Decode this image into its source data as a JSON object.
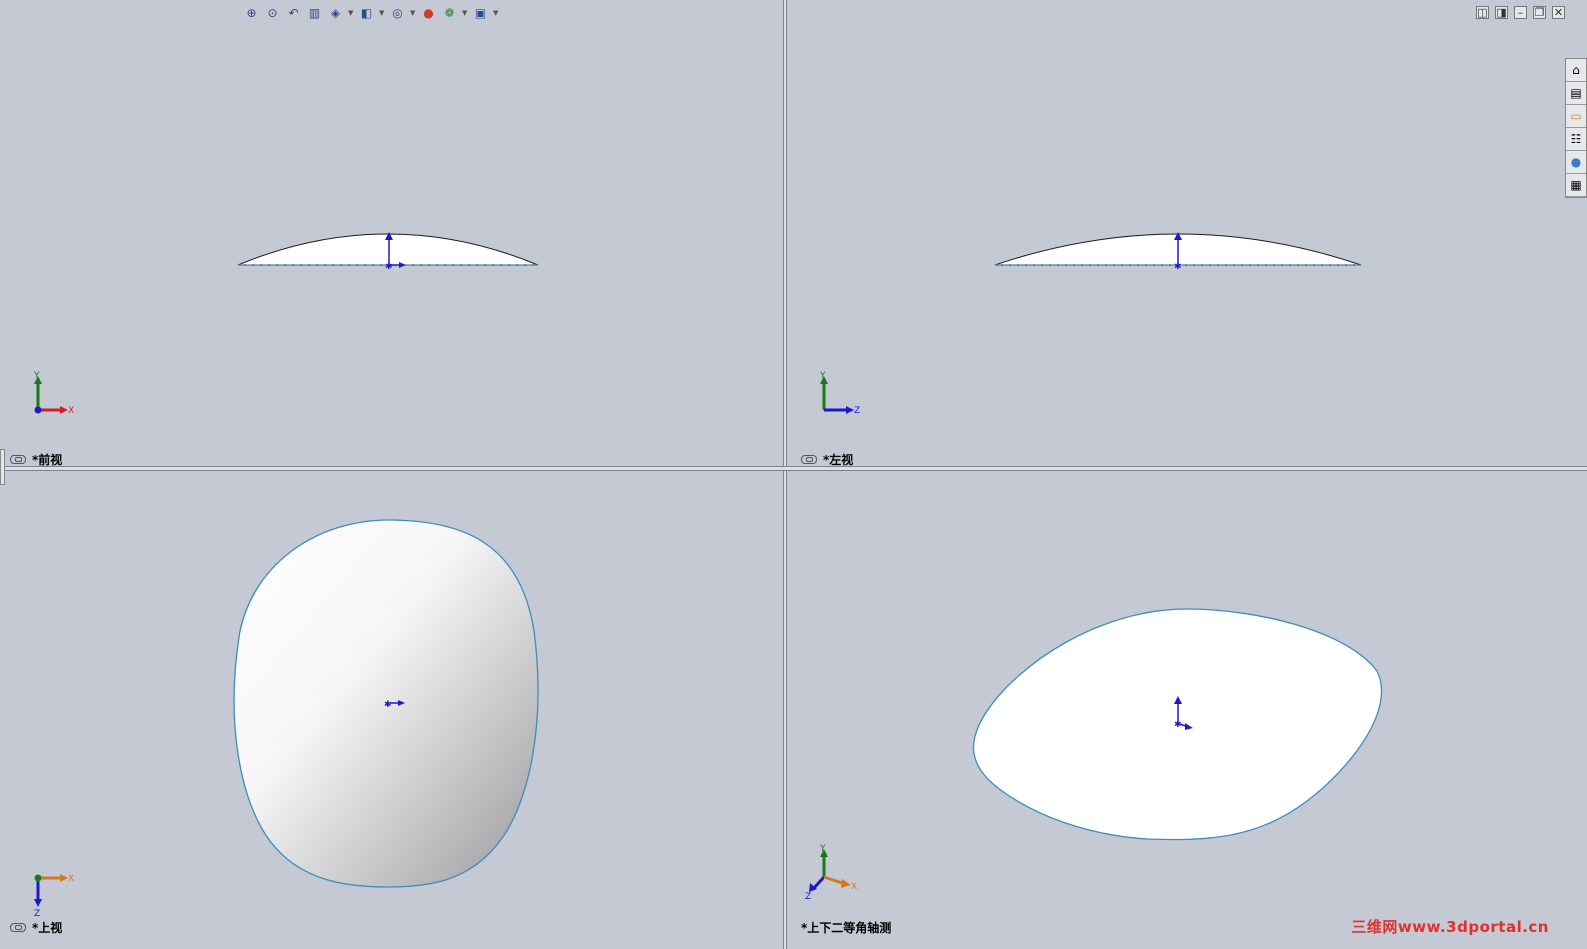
{
  "views": {
    "front": {
      "label": "*前视"
    },
    "left": {
      "label": "*左视"
    },
    "top": {
      "label": "*上视"
    },
    "dimetric": {
      "label": "*上下二等角轴测"
    }
  },
  "triads": {
    "front": {
      "up": "Y",
      "right": "X"
    },
    "left": {
      "up": "Y",
      "right": "Z"
    },
    "top": {
      "right": "X",
      "down": "Z"
    },
    "dimetric": {
      "up": "Y",
      "left": "Z",
      "right": "X"
    }
  },
  "toolbar": {
    "icons": [
      "zoom-to-fit-icon",
      "zoom-to-area-icon",
      "previous-view-icon",
      "section-view-icon",
      "view-orientation-icon",
      "display-style-icon",
      "hide-show-items-icon",
      "edit-appearance-icon",
      "apply-scene-icon",
      "view-settings-icon"
    ]
  },
  "task_pane": {
    "icons": [
      "solidworks-resources-icon",
      "design-library-icon",
      "file-explorer-icon",
      "view-palette-icon",
      "appearances-icon",
      "custom-properties-icon"
    ]
  },
  "colors": {
    "background": "#c5c9d4",
    "outline": "#3a8dbf",
    "axis_y": "#1a7a1a",
    "axis_x_red": "#cc2222",
    "axis_z_blue": "#1a1ac8",
    "axis_orange": "#d07a20"
  },
  "watermark": "三维网www.3dportal.cn"
}
